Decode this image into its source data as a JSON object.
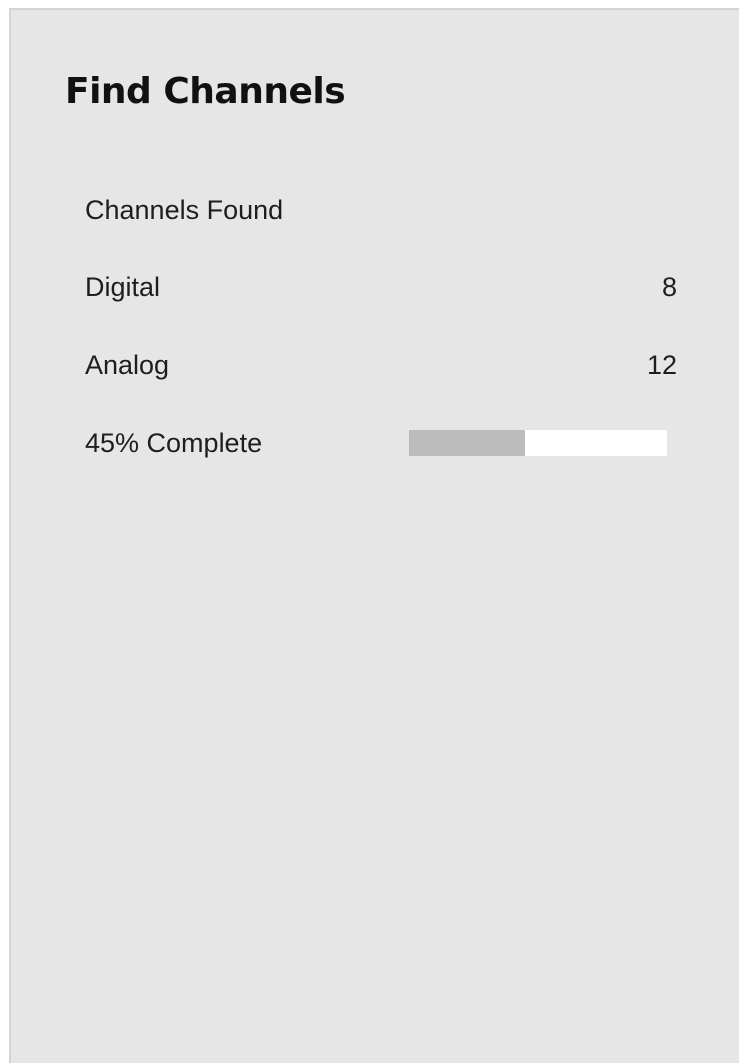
{
  "dialog": {
    "title": "Find Channels"
  },
  "scan": {
    "header_label": "Channels Found",
    "rows": [
      {
        "label": "Digital",
        "value": "8"
      },
      {
        "label": "Analog",
        "value": "12"
      }
    ],
    "progress": {
      "label": "45% Complete",
      "percent": 45
    }
  },
  "colors": {
    "panel_background": "#e6e6e6",
    "progress_fill": "#bcbcbc",
    "progress_track": "#ffffff",
    "text": "#1e1e1e"
  }
}
